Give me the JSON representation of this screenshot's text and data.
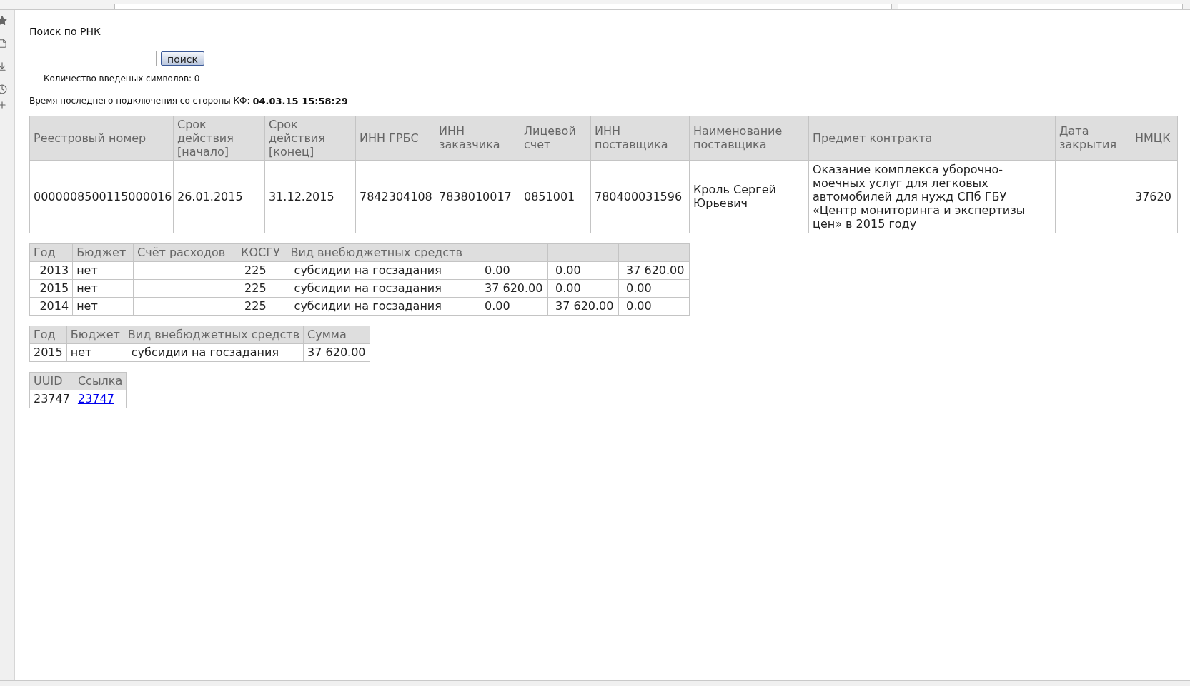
{
  "search": {
    "title": "Поиск по РНК",
    "button": "поиск",
    "counter": "Количество введеных символов: 0"
  },
  "last_connection": {
    "label": "Время последнего подключения со стороны КФ:",
    "value": "04.03.15 15:58:29"
  },
  "contract_table": {
    "columns": [
      "Реестровый номер",
      "Срок действия [начало]",
      "Срок действия [конец]",
      "ИНН ГРБС",
      "ИНН заказчика",
      "Лицевой счет",
      "ИНН поставщика",
      "Наименование поставщика",
      "Предмет контракта",
      "Дата закрытия",
      "НМЦК"
    ],
    "rows": [
      [
        "0000008500115000016",
        "26.01.2015",
        "31.12.2015",
        "7842304108",
        "7838010017",
        "0851001",
        "780400031596",
        "Кроль Сергей Юрьевич",
        "Оказание комплекса уборочно-моечных услуг для легковых автомобилей для нужд СПб ГБУ «Центр мониторинга и экспертизы цен» в 2015 году",
        null,
        "37620"
      ]
    ]
  },
  "budget_table": {
    "columns": [
      "Год",
      "Бюджет",
      "Счёт расходов",
      "КОСГУ",
      "Вид внебюджетных средств",
      null,
      null,
      null
    ],
    "rows": [
      [
        "2013",
        "нет",
        null,
        "225",
        "субсидии на госзадания",
        "0.00",
        "0.00",
        "37 620.00"
      ],
      [
        "2015",
        "нет",
        null,
        "225",
        "субсидии на госзадания",
        "37 620.00",
        "0.00",
        "0.00"
      ],
      [
        "2014",
        "нет",
        null,
        "225",
        "субсидии на госзадания",
        "0.00",
        "37 620.00",
        "0.00"
      ]
    ]
  },
  "sum_table": {
    "columns": [
      "Год",
      "Бюджет",
      "Вид внебюджетных средств",
      "Сумма"
    ],
    "rows": [
      [
        "2015",
        "нет",
        "субсидии на госзадания",
        "37 620.00"
      ]
    ]
  },
  "uuid_table": {
    "columns": [
      "UUID",
      "Ссылка"
    ],
    "rows": [
      [
        {
          "kind": "text",
          "text": "23747"
        },
        {
          "kind": "link",
          "text": "23747"
        }
      ]
    ]
  }
}
